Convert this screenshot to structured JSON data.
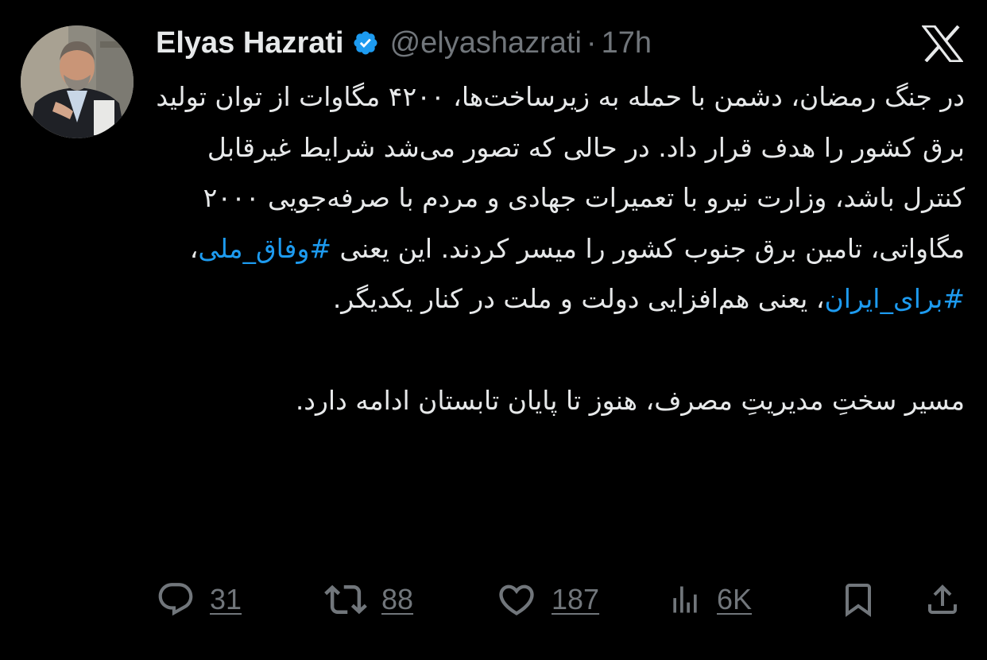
{
  "author": {
    "display_name": "Elyas Hazrati",
    "handle": "@elyashazrati",
    "separator": "·",
    "time": "17h",
    "verified": true,
    "verified_color": "#1d9bf0"
  },
  "post": {
    "paragraph_1_before_tags": "در جنگ رمضان، دشمن با حمله به زیرساخت‌ها، ۴۲۰۰ مگاوات از توان تولید برق کشور را هدف قرار داد. در حالی که تصور می‌شد شرایط غیرقابل کنترل باشد، وزارت نیرو با تعمیرات جهادی و مردم با صرفه‌جویی ۲۰۰۰ مگاواتی، تامین برق جنوب کشور را میسر کردند. این یعنی ",
    "hashtag_1": "#وفاق_ملی",
    "separator": "، ",
    "hashtag_2": "#برای_ایران",
    "paragraph_1_after_tags": "، یعنی هم‌افزایی دولت و ملت در کنار یکدیگر.",
    "paragraph_2": "مسیر سختِ مدیریتِ مصرف، هنوز تا پایان تابستان ادامه دارد.",
    "hashtag_color": "#1d9bf0"
  },
  "actions": {
    "replies": "31",
    "reposts": "88",
    "likes": "187",
    "views": "6K"
  },
  "icons": {
    "platform": "x-logo-icon",
    "reply": "reply-icon",
    "repost": "repost-icon",
    "like": "heart-icon",
    "views": "views-chart-icon",
    "bookmark": "bookmark-icon",
    "share": "share-icon"
  },
  "colors": {
    "background": "#000000",
    "text": "#e7e9ea",
    "muted": "#71767b"
  }
}
